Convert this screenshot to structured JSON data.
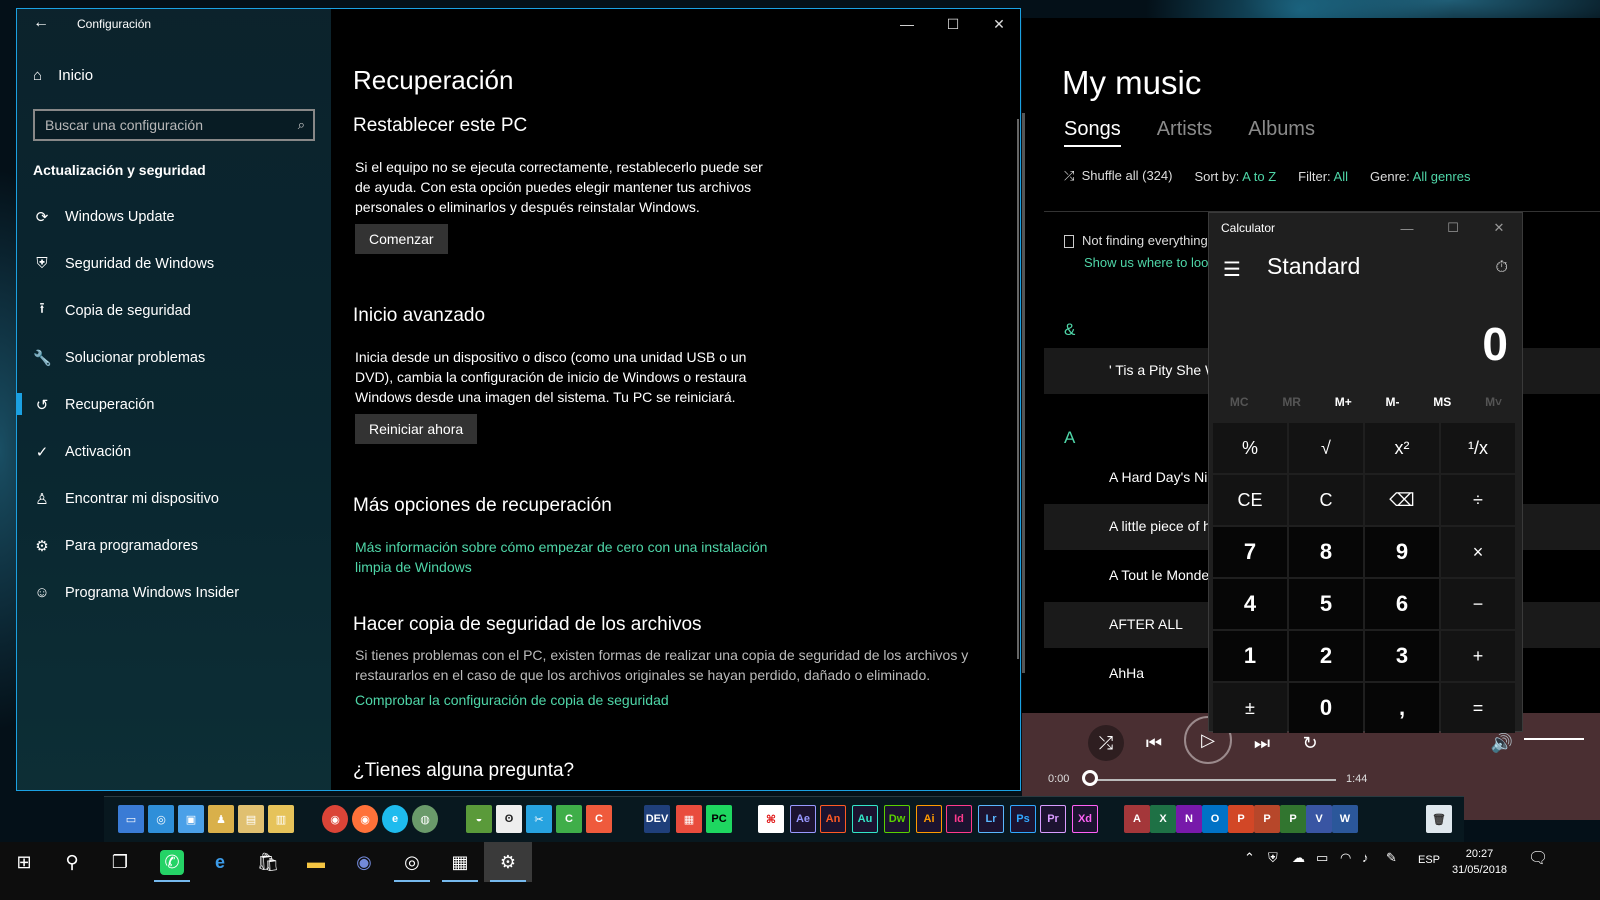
{
  "music": {
    "title": "My music",
    "tabs": [
      "Songs",
      "Artists",
      "Albums"
    ],
    "shuffle_label": "Shuffle all (324)",
    "sort_label": "Sort by:",
    "sort_value": "A to Z",
    "filter_label": "Filter:",
    "filter_value": "All",
    "genre_label": "Genre:",
    "genre_value": "All genres",
    "notice_text": "Not finding everything?",
    "notice_link": "Show us where to look fo",
    "group_amp": "&",
    "group_a": "A",
    "songs": [
      " ' Tis a Pity She Was",
      "A Hard Day's Night",
      "A little piece of hea",
      "A Tout le Monde",
      "AFTER ALL",
      "AhHa"
    ],
    "time_elapsed": "0:00",
    "time_total": "1:44"
  },
  "settings": {
    "window_title": "Configuración",
    "home": "Inicio",
    "search_placeholder": "Buscar una configuración",
    "section": "Actualización y seguridad",
    "nav": [
      "Windows Update",
      "Seguridad de Windows",
      "Copia de seguridad",
      "Solucionar problemas",
      "Recuperación",
      "Activación",
      "Encontrar mi dispositivo",
      "Para programadores",
      "Programa Windows Insider"
    ],
    "page_title": "Recuperación",
    "reset_heading": "Restablecer este PC",
    "reset_text_1": "Si el equipo no se ejecuta correctamente, restablecerlo puede ser",
    "reset_text_2": "de ayuda. Con esta opción puedes elegir mantener tus archivos",
    "reset_text_3": "personales o eliminarlos y después reinstalar Windows.",
    "reset_button": "Comenzar",
    "advanced_heading": "Inicio avanzado",
    "advanced_text_1": "Inicia desde un dispositivo o disco (como una unidad USB o un",
    "advanced_text_2": "DVD), cambia la configuración de inicio de Windows o restaura",
    "advanced_text_3": "Windows desde una imagen del sistema. Tu PC se reiniciará.",
    "advanced_button": "Reiniciar ahora",
    "more_heading": "Más opciones de recuperación",
    "more_link_1": "Más información sobre cómo empezar de cero con una instalación",
    "more_link_2": "limpia de Windows",
    "backup_heading": "Hacer copia de seguridad de los archivos",
    "backup_text_1": "Si tienes problemas con el PC, existen formas de realizar una copia de seguridad de los archivos y",
    "backup_text_2": "restaurarlos en el caso de que los archivos originales se hayan perdido, dañado o eliminado.",
    "backup_link": "Comprobar la configuración de copia de seguridad",
    "question_heading": "¿Tienes alguna pregunta?"
  },
  "calculator": {
    "title": "Calculator",
    "mode": "Standard",
    "display": "0",
    "memory": [
      "MC",
      "MR",
      "M+",
      "M-",
      "MS",
      "M˅"
    ],
    "keys": [
      "%",
      "√",
      "x²",
      "¹/x",
      "CE",
      "C",
      "⌫",
      "÷",
      "7",
      "8",
      "9",
      "×",
      "4",
      "5",
      "6",
      "−",
      "1",
      "2",
      "3",
      "+",
      "±",
      "0",
      ",",
      "="
    ]
  },
  "dock": {
    "adobe": [
      "Ae",
      "An",
      "Au",
      "Dw",
      "Ai",
      "Id",
      "Lr",
      "Ps",
      "Pr",
      "Xd"
    ],
    "adobe_colors": [
      "#9999ff",
      "#ff5a24",
      "#33e6c8",
      "#5ad100",
      "#ff9a00",
      "#ff3a8c",
      "#5ab7ff",
      "#31a8ff",
      "#d99cff",
      "#ff61f6"
    ],
    "office": [
      "A",
      "X",
      "N",
      "O",
      "P",
      "P",
      "P",
      "V",
      "W"
    ],
    "office_colors": [
      "#a4373a",
      "#1e7145",
      "#7719aa",
      "#0072c6",
      "#d24726",
      "#b7472a",
      "#31752f",
      "#3955a3",
      "#2b579a"
    ]
  },
  "taskbar": {
    "language": "ESP",
    "time": "20:27",
    "date": "31/05/2018"
  }
}
